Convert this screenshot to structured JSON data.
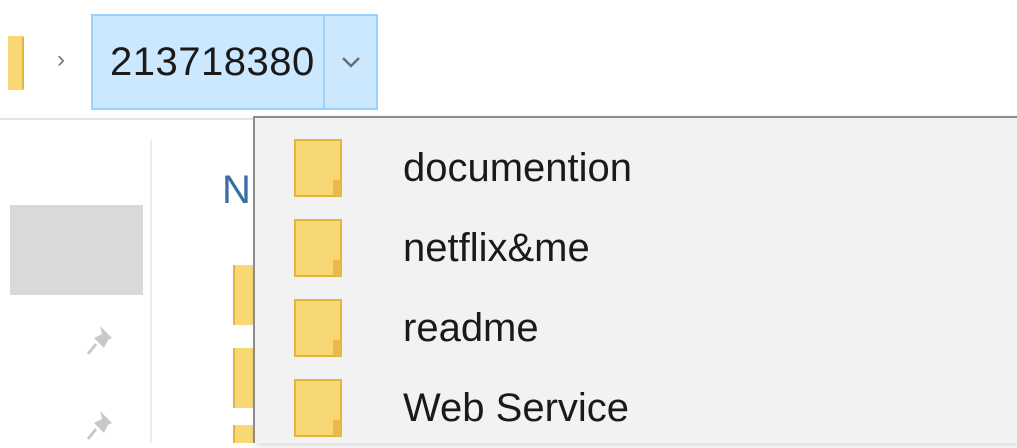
{
  "address_bar": {
    "separator": "›",
    "current_folder": "213718380"
  },
  "background": {
    "column_header_letter": "N"
  },
  "dropdown": {
    "items": [
      {
        "label": "documention",
        "icon": "folder-icon"
      },
      {
        "label": "netflix&me",
        "icon": "folder-icon"
      },
      {
        "label": "readme",
        "icon": "folder-icon"
      },
      {
        "label": "Web Service",
        "icon": "folder-icon"
      }
    ]
  },
  "colors": {
    "breadcrumb_bg": "#cce8ff",
    "breadcrumb_border": "#99d1ff",
    "folder_yellow": "#f8d775",
    "folder_edge": "#e2b53f",
    "menu_bg": "#f2f2f2",
    "menu_border": "#8c8c8c"
  }
}
